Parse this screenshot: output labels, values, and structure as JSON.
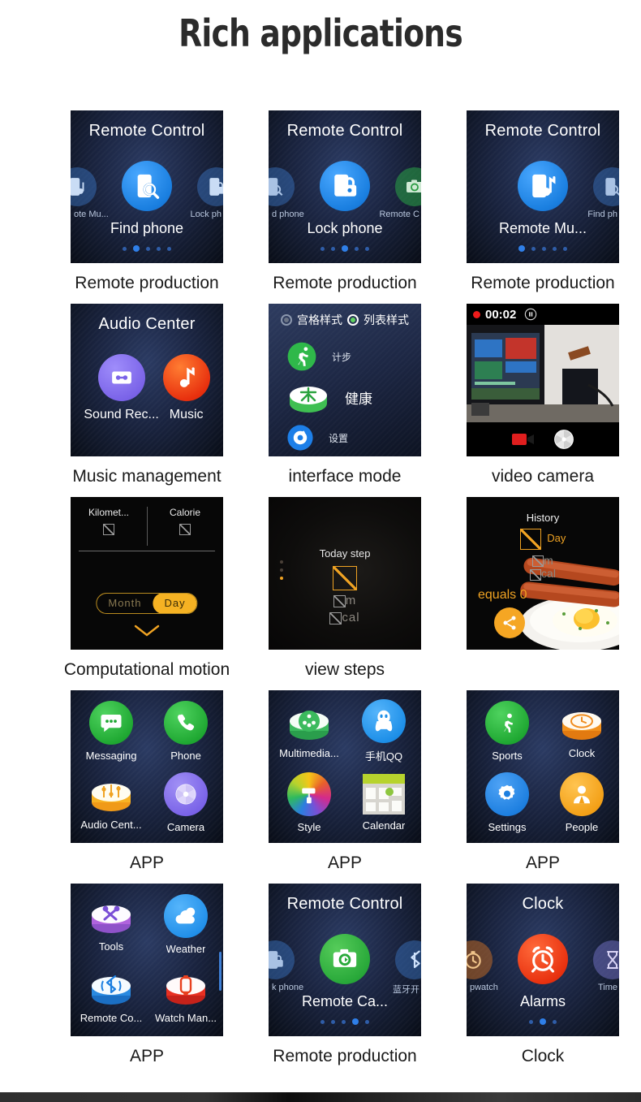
{
  "title": "Rich applications",
  "cards": [
    {
      "caption": "Remote production",
      "type": "remote",
      "header": "Remote Control",
      "center_label": "Find phone",
      "center_icon": "find-phone-icon",
      "left_label": "ote Mu...",
      "left_icon": "remote-music-icon",
      "right_label": "Lock ph",
      "right_icon": "lock-phone-icon",
      "dots": 5,
      "active_dot": 2
    },
    {
      "caption": "Remote production",
      "type": "remote",
      "header": "Remote Control",
      "center_label": "Lock phone",
      "center_icon": "lock-phone-icon",
      "left_label": "d phone",
      "left_icon": "find-phone-icon",
      "right_label": "Remote C",
      "right_icon": "remote-camera-icon",
      "dots": 5,
      "active_dot": 3
    },
    {
      "caption": "Remote production",
      "type": "remote",
      "header": "Remote Control",
      "center_label": "Remote Mu...",
      "center_icon": "remote-music-icon",
      "left_label": "",
      "left_icon": "",
      "right_label": "Find ph",
      "right_icon": "find-phone-icon",
      "dots": 5,
      "active_dot": 1
    },
    {
      "caption": "Music management",
      "type": "audio",
      "header": "Audio Center",
      "items": [
        {
          "label": "Sound Rec...",
          "icon": "cassette-icon",
          "color": "#7a63e8"
        },
        {
          "label": "Music",
          "icon": "music-note-icon",
          "color": "#e8300e"
        }
      ]
    },
    {
      "caption": "interface mode",
      "type": "interface",
      "option_grid": "宫格样式",
      "option_list": "列表样式",
      "selected": "list",
      "rows": [
        {
          "label": "计步",
          "icon": "running-icon"
        },
        {
          "label": "健康",
          "icon": "health-icon"
        },
        {
          "label": "设置",
          "icon": "gear-icon"
        }
      ]
    },
    {
      "caption": "video camera",
      "type": "video",
      "timer": "00:02",
      "rec_icon": "record-dot-icon",
      "pause_icon": "pause-icon",
      "video_icon": "video-record-icon",
      "shutter_icon": "shutter-icon"
    },
    {
      "caption": "Computational motion",
      "type": "motion",
      "col1": "Kilomet...",
      "col2": "Calorie",
      "val1": "",
      "val2": "",
      "toggle_left": "Month",
      "toggle_right": "Day",
      "toggle_active": "Day",
      "chevron": "chevron-down-icon"
    },
    {
      "caption": "view steps",
      "type": "steps",
      "heading": "Today step",
      "value": "",
      "unit_m": "m",
      "unit_cal": "cal",
      "dots": 3,
      "active_dot": 3
    },
    {
      "caption": "",
      "type": "history",
      "heading": "History",
      "day_label": "Day",
      "unit_m": "m",
      "unit_cal": "cal",
      "equals": "equals 0",
      "share_icon": "share-icon"
    },
    {
      "caption": "APP",
      "type": "app",
      "items": [
        {
          "label": "Messaging",
          "icon": "messaging-icon",
          "color": "#2bb53a",
          "style": "flat"
        },
        {
          "label": "Phone",
          "icon": "phone-icon",
          "color": "#2bb53a",
          "style": "flat"
        },
        {
          "label": "Audio Cent...",
          "icon": "audio-center-icon",
          "color": "#f0b429",
          "style": "3d"
        },
        {
          "label": "Camera",
          "icon": "camera-aperture-icon",
          "color": "#8472e8",
          "style": "flat"
        }
      ]
    },
    {
      "caption": "APP",
      "type": "app",
      "items": [
        {
          "label": "Multimedia...",
          "icon": "multimedia-icon",
          "color": "#2fba5e",
          "style": "3d"
        },
        {
          "label": "手机QQ",
          "icon": "qq-penguin-icon",
          "color": "#2a9df4",
          "style": "flat"
        },
        {
          "label": "Style",
          "icon": "paint-roller-icon",
          "color": "#e8a33d",
          "style": "flat"
        },
        {
          "label": "Calendar",
          "icon": "calendar-icon",
          "color": "#b7d32d",
          "style": "square"
        }
      ]
    },
    {
      "caption": "APP",
      "type": "app",
      "items": [
        {
          "label": "Sports",
          "icon": "running-icon",
          "color": "#2bb53a",
          "style": "flat"
        },
        {
          "label": "Clock",
          "icon": "clock-icon",
          "color": "#f08c1e",
          "style": "3d"
        },
        {
          "label": "Settings",
          "icon": "gear-icon",
          "color": "#2a7fe0",
          "style": "flat"
        },
        {
          "label": "People",
          "icon": "people-icon",
          "color": "#f5a623",
          "style": "flat"
        }
      ]
    },
    {
      "caption": "APP",
      "type": "app",
      "scrollbar": true,
      "items": [
        {
          "label": "Tools",
          "icon": "tools-icon",
          "color": "#b06ad6",
          "style": "3d"
        },
        {
          "label": "Weather",
          "icon": "weather-icon",
          "color": "#2a9df4",
          "style": "flat"
        },
        {
          "label": "Remote Co...",
          "icon": "bluetooth-icon",
          "color": "#2a7fe0",
          "style": "3d"
        },
        {
          "label": "Watch Man...",
          "icon": "watch-icon",
          "color": "#e83022",
          "style": "3d"
        }
      ]
    },
    {
      "caption": "Remote production",
      "type": "remote",
      "header": "Remote Control",
      "center_label": "Remote Ca...",
      "center_icon": "remote-camera-icon",
      "left_label": "k phone",
      "left_icon": "lock-phone-icon",
      "right_label": "蓝牙开",
      "right_icon": "bluetooth-icon",
      "dots": 5,
      "active_dot": 4
    },
    {
      "caption": "Clock",
      "type": "remote",
      "header": "Clock",
      "center_label": "Alarms",
      "center_icon": "alarm-clock-icon",
      "left_label": "pwatch",
      "left_icon": "stopwatch-icon",
      "right_label": "Time",
      "right_icon": "hourglass-icon",
      "dots": 3,
      "active_dot": 2
    }
  ]
}
